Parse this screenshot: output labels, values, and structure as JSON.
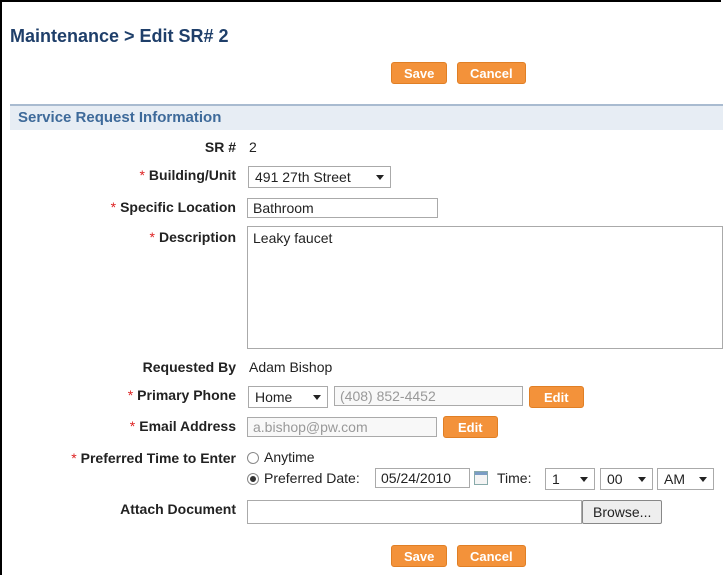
{
  "breadcrumb": "Maintenance > Edit SR# 2",
  "buttons": {
    "save": "Save",
    "cancel": "Cancel",
    "edit": "Edit",
    "browse": "Browse..."
  },
  "section_title": "Service Request Information",
  "required_mark": "*",
  "fields": {
    "sr_label": "SR #",
    "sr_value": "2",
    "building_label": "Building/Unit",
    "building_value": "491 27th Street",
    "location_label": "Specific Location",
    "location_value": "Bathroom",
    "description_label": "Description",
    "description_value": "Leaky faucet",
    "requested_by_label": "Requested By",
    "requested_by_value": "Adam Bishop",
    "phone_label": "Primary Phone",
    "phone_type": "Home",
    "phone_value": "(408) 852-4452",
    "email_label": "Email Address",
    "email_value": "a.bishop@pw.com",
    "pref_time_label": "Preferred Time to Enter",
    "anytime_label": "Anytime",
    "pref_date_label": "Preferred Date:",
    "pref_date_value": "05/24/2010",
    "time_label": "Time:",
    "hour": "1",
    "minute": "00",
    "ampm": "AM",
    "attach_label": "Attach Document"
  },
  "colors": {
    "accent": "#f3923a",
    "title": "#1f3f6a",
    "section_text": "#3e6a9a",
    "section_bg": "#e7edf4",
    "required": "#dd2222"
  }
}
